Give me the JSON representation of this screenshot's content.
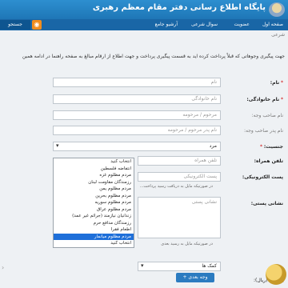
{
  "header": {
    "title": "پایگاه اطلاع رسانی دفتر مقام معظم رهبری"
  },
  "nav": {
    "items": [
      "صفحه اول",
      "عضویت",
      "سوال شرعی",
      "آرشیو جامع"
    ],
    "search_label": "جستجو",
    "rss_icon": "rss-icon"
  },
  "breadcrumb": "شرعی",
  "intro_text": "جهت پیگیری وجوهاتی که قبلاً پرداخت کرده اید به قسمت پیگیری پرداخت و جهت اطلاع از ارقام مبالغ به صفحه راهنما در ادامه همین",
  "form": {
    "name": {
      "label": "نام:",
      "placeholder": "نام"
    },
    "lastname": {
      "label": "نام خانوادگی:",
      "placeholder": "نام خانوادگی"
    },
    "owner_name": {
      "label": "نام صاحب وجه:",
      "placeholder": "مرحوم / مرحومه"
    },
    "owner_father": {
      "label": "نام پدر صاحب وجه:",
      "placeholder": "نام پدر مرحوم / مرحومه"
    },
    "gender": {
      "label": "جنسیت:",
      "value": "مرد"
    },
    "mobile": {
      "label": "تلفن همراه:",
      "placeholder": "تلفن همراه"
    },
    "email": {
      "label": "پست الکترونیکی:",
      "placeholder": "پست الکترونیکی",
      "hint": "در صورتیکه مایل به دریافت رسید پرداخت..."
    },
    "address": {
      "label": "نشانی پستی:",
      "placeholder": "نشانی پستی",
      "hint": "در صورتیکه مایل به رسید بعدی"
    },
    "purpose_select": {
      "options": [
        "انتخاب کنید",
        "انتفاضه فلسطین",
        "مردم مظلوم غزه",
        "رزمندگان مقاومت لبنان",
        "مردم مظلوم یمن",
        "مردم مظلوم بحرین",
        "مردم مظلوم سوریه",
        "مردم مظلوم عراق",
        "زندانیان نیازمند (جرائم غیر عمد)",
        "رزمندگان مدافع حرم",
        "اطعام فقرا",
        "مردم مظلوم میانمار",
        "انتخاب کنید"
      ],
      "selected_index": 11
    },
    "help_select": "کمک ها",
    "add_button": "وجه بعدی +",
    "total_label": "جمع کل (ریال):"
  }
}
